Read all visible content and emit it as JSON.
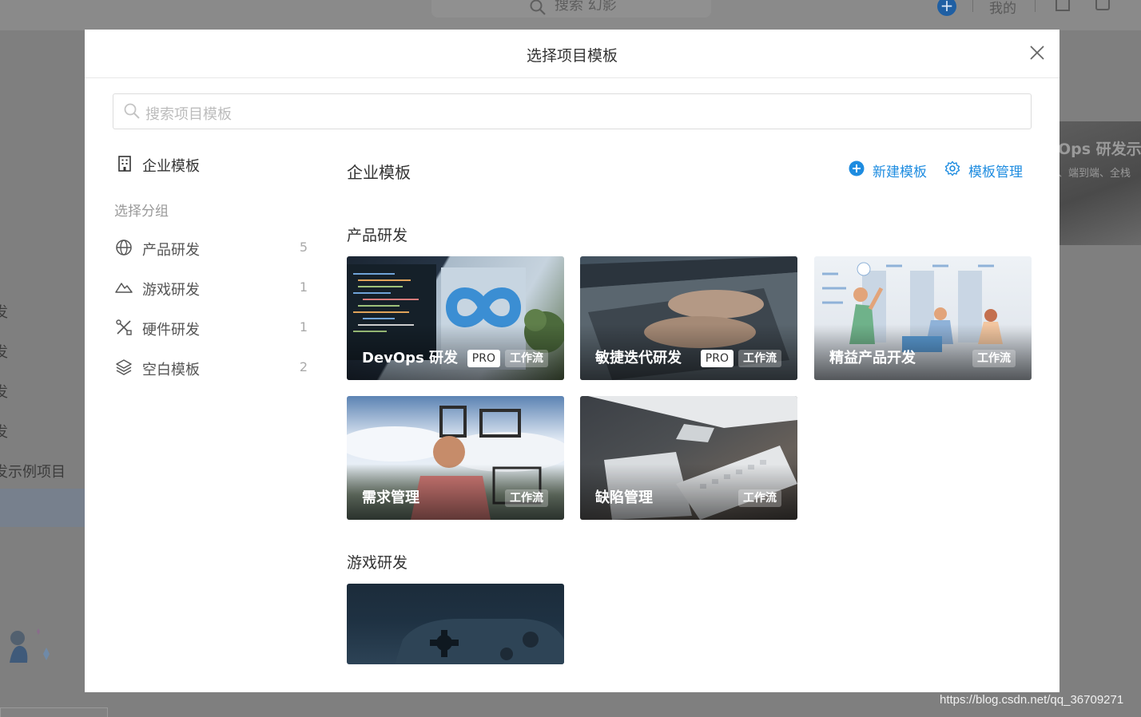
{
  "background": {
    "search_placeholder": "搜索 幻影",
    "mine_label": "我的",
    "left_nav": [
      "发",
      "发",
      "发",
      "发",
      "发示例项目"
    ],
    "right_card_title": "Ops 研发示例",
    "right_card_subtitle": "、端到端、全栈"
  },
  "modal": {
    "title": "选择项目模板",
    "search_placeholder": "搜索项目模板"
  },
  "sidebar": {
    "enterprise_label": "企业模板",
    "group_title": "选择分组",
    "items": [
      {
        "label": "产品研发",
        "count": "5",
        "icon": "globe-icon"
      },
      {
        "label": "游戏研发",
        "count": "1",
        "icon": "mountain-icon"
      },
      {
        "label": "硬件研发",
        "count": "1",
        "icon": "tools-icon"
      },
      {
        "label": "空白模板",
        "count": "2",
        "icon": "layers-icon"
      }
    ]
  },
  "main": {
    "title": "企业模板",
    "new_template": "新建模板",
    "manage_template": "模板管理",
    "sections": [
      {
        "title": "产品研发",
        "cards": [
          {
            "name": "DevOps 研发",
            "pro": "PRO",
            "flow": "工作流"
          },
          {
            "name": "敏捷迭代研发",
            "pro": "PRO",
            "flow": "工作流"
          },
          {
            "name": "精益产品开发",
            "flow": "工作流"
          },
          {
            "name": "需求管理",
            "flow": "工作流"
          },
          {
            "name": "缺陷管理",
            "flow": "工作流"
          }
        ]
      },
      {
        "title": "游戏研发",
        "cards": [
          {
            "name": ""
          }
        ]
      }
    ]
  },
  "watermark": "https://blog.csdn.net/qq_36709271",
  "colors": {
    "accent": "#1e8ce0",
    "overlay": "#7f7f7f"
  }
}
